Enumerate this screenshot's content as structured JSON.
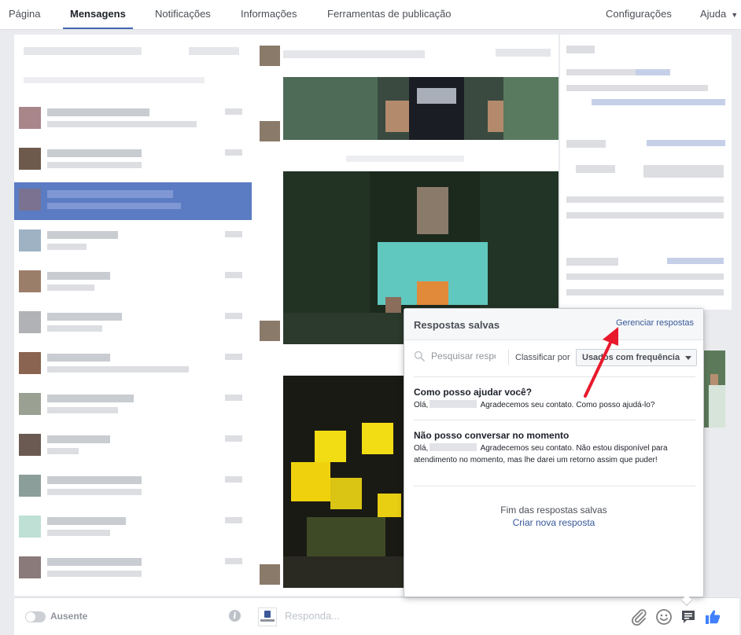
{
  "nav": {
    "tabs": [
      {
        "label": "Página",
        "active": false
      },
      {
        "label": "Mensagens",
        "active": true
      },
      {
        "label": "Notificações",
        "active": false
      },
      {
        "label": "Informações",
        "active": false
      },
      {
        "label": "Ferramentas de publicação",
        "active": false
      }
    ],
    "settings_label": "Configurações",
    "help_label": "Ajuda"
  },
  "left_panel": {
    "status_label": "Ausente"
  },
  "composer": {
    "placeholder": "Responda..."
  },
  "saved_replies": {
    "title": "Respostas salvas",
    "manage_link": "Gerenciar respostas",
    "search_placeholder": "Pesquisar respostas",
    "sort_label": "Classificar por",
    "sort_value": "Usados com frequência",
    "replies": [
      {
        "title": "Como posso ajudar você?",
        "greeting": "Olá,",
        "body": "Agradecemos seu contato. Como posso ajudá-lo?"
      },
      {
        "title": "Não posso conversar no momento",
        "greeting": "Olá,",
        "body": "Agradecemos seu contato. Não estou disponível para atendimento no momento, mas lhe darei um retorno assim que puder!"
      }
    ],
    "end_text": "Fim das respostas salvas",
    "create_link": "Criar nova resposta"
  },
  "colors": {
    "accent": "#4267b2",
    "link": "#365899",
    "selected_row": "#5b7bc3",
    "annotation_arrow": "#e8192c"
  }
}
